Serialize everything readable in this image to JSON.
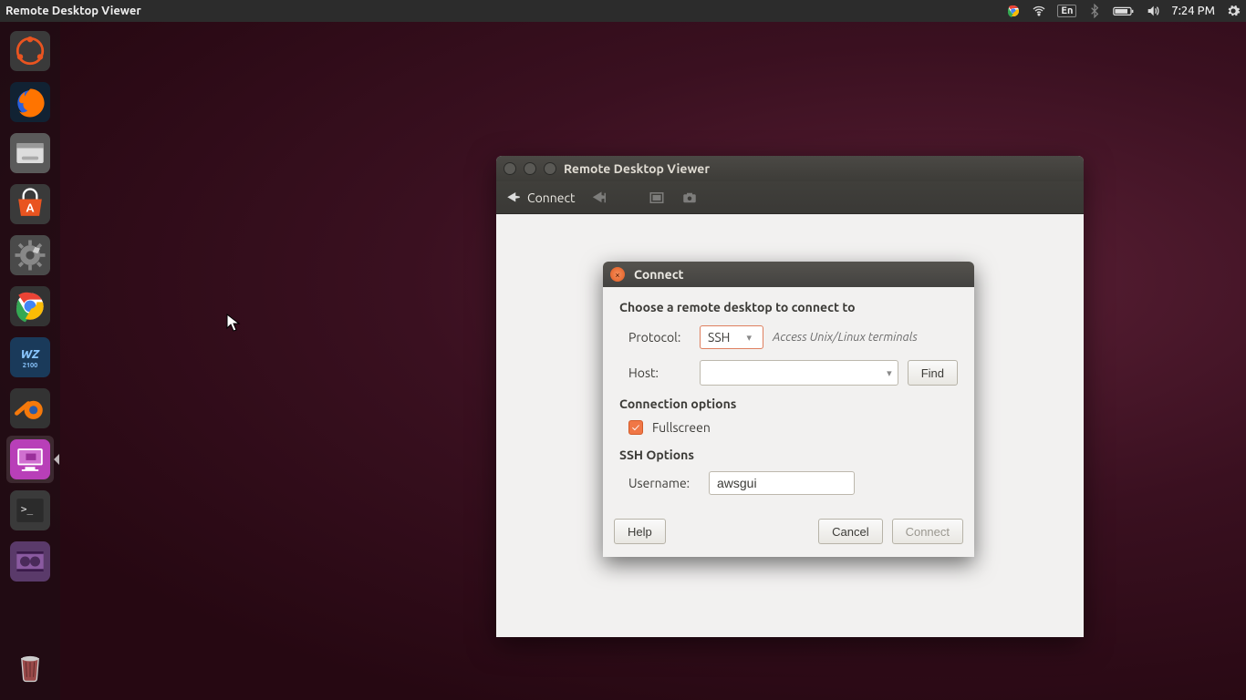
{
  "topbar": {
    "title": "Remote Desktop Viewer",
    "lang": "En",
    "time": "7:24 PM"
  },
  "appwin": {
    "title": "Remote Desktop Viewer",
    "toolbar": {
      "connect": "Connect"
    }
  },
  "dialog": {
    "title": "Connect",
    "heading": "Choose a remote desktop to connect to",
    "protocol_label": "Protocol:",
    "protocol_value": "SSH",
    "protocol_hint": "Access Unix/Linux terminals",
    "host_label": "Host:",
    "host_value": "",
    "find_label": "Find",
    "conn_options": "Connection options",
    "fullscreen_label": "Fullscreen",
    "fullscreen_checked": true,
    "ssh_options": "SSH Options",
    "username_label": "Username:",
    "username_value": "awsgui",
    "help": "Help",
    "cancel": "Cancel",
    "connect": "Connect"
  }
}
